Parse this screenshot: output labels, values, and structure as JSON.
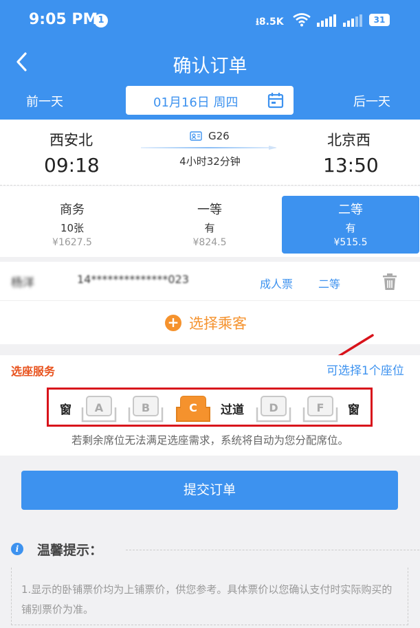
{
  "status_bar": {
    "time": "9:05 PM",
    "notification_count": "1",
    "net_speed": "8.5K",
    "battery": "31"
  },
  "header": {
    "title": "确认订单",
    "prev_day": "前一天",
    "next_day": "后一天",
    "date": "01月16日 周四",
    "accent_color": "#3d92ef"
  },
  "train": {
    "from_station": "西安北",
    "from_time": "09:18",
    "to_station": "北京西",
    "to_time": "13:50",
    "train_no": "G26",
    "duration": "4小时32分钟"
  },
  "seat_classes": [
    {
      "name": "商务",
      "availability": "10张",
      "price": "¥1627.5",
      "selected": false
    },
    {
      "name": "一等",
      "availability": "有",
      "price": "¥824.5",
      "selected": false
    },
    {
      "name": "二等",
      "availability": "有",
      "price": "¥515.5",
      "selected": true
    }
  ],
  "passenger": {
    "name": "杨洋",
    "id_number": "14**************023",
    "ticket_type": "成人票",
    "seat_class": "二等",
    "add_label": "选择乘客"
  },
  "seat_selection": {
    "title": "选座服务",
    "hint": "可选择1个座位",
    "window_label": "窗",
    "aisle_label": "过道",
    "seats": [
      {
        "letter": "A",
        "selected": false
      },
      {
        "letter": "B",
        "selected": false
      },
      {
        "letter": "C",
        "selected": true
      },
      {
        "letter": "D",
        "selected": false
      },
      {
        "letter": "F",
        "selected": false
      }
    ],
    "note": "若剩余席位无法满足选座需求，系统将自动为您分配席位。"
  },
  "submit_label": "提交订单",
  "tips": {
    "title": "温馨提示：",
    "text": "1.显示的卧铺票价均为上铺票价，供您参考。具体票价以您确认支付时实际购买的铺别票价为准。"
  },
  "icons": {
    "back": "back-arrow-icon",
    "calendar": "calendar-icon",
    "id_card": "id-card-icon",
    "trash": "trash-icon",
    "plus": "plus-circle-icon",
    "info": "info-icon"
  }
}
